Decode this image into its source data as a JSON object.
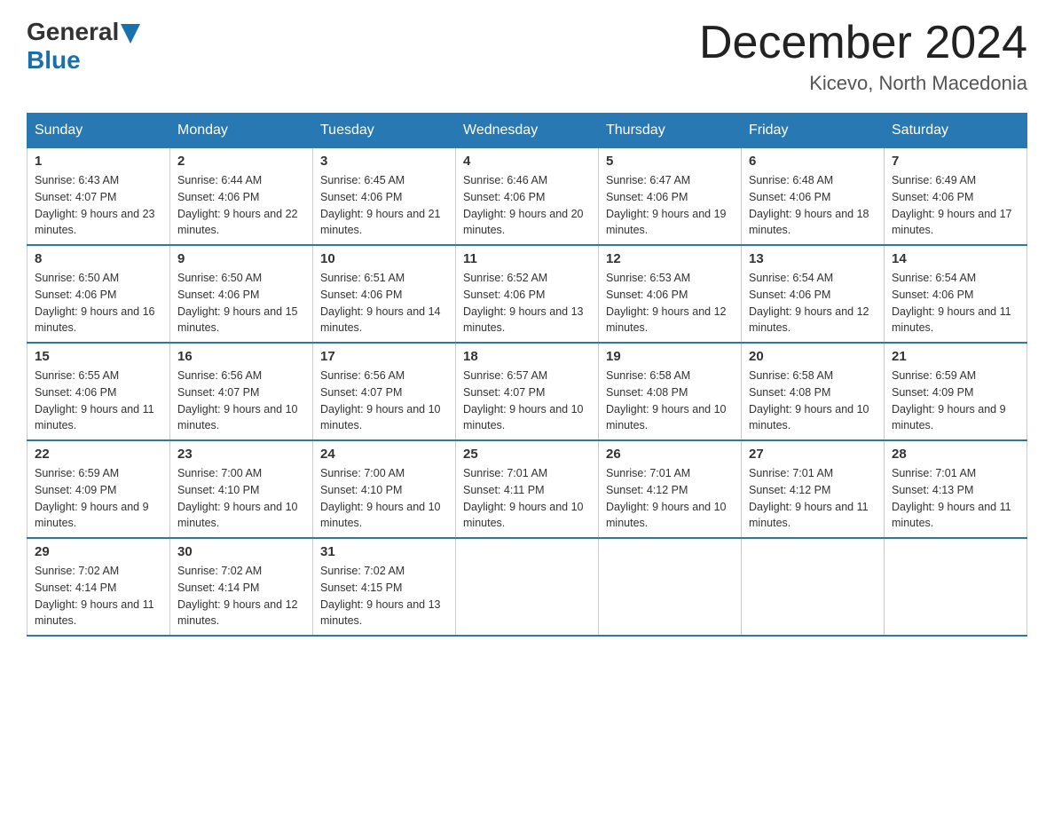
{
  "header": {
    "logo_general": "General",
    "logo_blue": "Blue",
    "month_title": "December 2024",
    "location": "Kicevo, North Macedonia"
  },
  "days_of_week": [
    "Sunday",
    "Monday",
    "Tuesday",
    "Wednesday",
    "Thursday",
    "Friday",
    "Saturday"
  ],
  "weeks": [
    [
      {
        "day": "1",
        "sunrise": "6:43 AM",
        "sunset": "4:07 PM",
        "daylight": "9 hours and 23 minutes."
      },
      {
        "day": "2",
        "sunrise": "6:44 AM",
        "sunset": "4:06 PM",
        "daylight": "9 hours and 22 minutes."
      },
      {
        "day": "3",
        "sunrise": "6:45 AM",
        "sunset": "4:06 PM",
        "daylight": "9 hours and 21 minutes."
      },
      {
        "day": "4",
        "sunrise": "6:46 AM",
        "sunset": "4:06 PM",
        "daylight": "9 hours and 20 minutes."
      },
      {
        "day": "5",
        "sunrise": "6:47 AM",
        "sunset": "4:06 PM",
        "daylight": "9 hours and 19 minutes."
      },
      {
        "day": "6",
        "sunrise": "6:48 AM",
        "sunset": "4:06 PM",
        "daylight": "9 hours and 18 minutes."
      },
      {
        "day": "7",
        "sunrise": "6:49 AM",
        "sunset": "4:06 PM",
        "daylight": "9 hours and 17 minutes."
      }
    ],
    [
      {
        "day": "8",
        "sunrise": "6:50 AM",
        "sunset": "4:06 PM",
        "daylight": "9 hours and 16 minutes."
      },
      {
        "day": "9",
        "sunrise": "6:50 AM",
        "sunset": "4:06 PM",
        "daylight": "9 hours and 15 minutes."
      },
      {
        "day": "10",
        "sunrise": "6:51 AM",
        "sunset": "4:06 PM",
        "daylight": "9 hours and 14 minutes."
      },
      {
        "day": "11",
        "sunrise": "6:52 AM",
        "sunset": "4:06 PM",
        "daylight": "9 hours and 13 minutes."
      },
      {
        "day": "12",
        "sunrise": "6:53 AM",
        "sunset": "4:06 PM",
        "daylight": "9 hours and 12 minutes."
      },
      {
        "day": "13",
        "sunrise": "6:54 AM",
        "sunset": "4:06 PM",
        "daylight": "9 hours and 12 minutes."
      },
      {
        "day": "14",
        "sunrise": "6:54 AM",
        "sunset": "4:06 PM",
        "daylight": "9 hours and 11 minutes."
      }
    ],
    [
      {
        "day": "15",
        "sunrise": "6:55 AM",
        "sunset": "4:06 PM",
        "daylight": "9 hours and 11 minutes."
      },
      {
        "day": "16",
        "sunrise": "6:56 AM",
        "sunset": "4:07 PM",
        "daylight": "9 hours and 10 minutes."
      },
      {
        "day": "17",
        "sunrise": "6:56 AM",
        "sunset": "4:07 PM",
        "daylight": "9 hours and 10 minutes."
      },
      {
        "day": "18",
        "sunrise": "6:57 AM",
        "sunset": "4:07 PM",
        "daylight": "9 hours and 10 minutes."
      },
      {
        "day": "19",
        "sunrise": "6:58 AM",
        "sunset": "4:08 PM",
        "daylight": "9 hours and 10 minutes."
      },
      {
        "day": "20",
        "sunrise": "6:58 AM",
        "sunset": "4:08 PM",
        "daylight": "9 hours and 10 minutes."
      },
      {
        "day": "21",
        "sunrise": "6:59 AM",
        "sunset": "4:09 PM",
        "daylight": "9 hours and 9 minutes."
      }
    ],
    [
      {
        "day": "22",
        "sunrise": "6:59 AM",
        "sunset": "4:09 PM",
        "daylight": "9 hours and 9 minutes."
      },
      {
        "day": "23",
        "sunrise": "7:00 AM",
        "sunset": "4:10 PM",
        "daylight": "9 hours and 10 minutes."
      },
      {
        "day": "24",
        "sunrise": "7:00 AM",
        "sunset": "4:10 PM",
        "daylight": "9 hours and 10 minutes."
      },
      {
        "day": "25",
        "sunrise": "7:01 AM",
        "sunset": "4:11 PM",
        "daylight": "9 hours and 10 minutes."
      },
      {
        "day": "26",
        "sunrise": "7:01 AM",
        "sunset": "4:12 PM",
        "daylight": "9 hours and 10 minutes."
      },
      {
        "day": "27",
        "sunrise": "7:01 AM",
        "sunset": "4:12 PM",
        "daylight": "9 hours and 11 minutes."
      },
      {
        "day": "28",
        "sunrise": "7:01 AM",
        "sunset": "4:13 PM",
        "daylight": "9 hours and 11 minutes."
      }
    ],
    [
      {
        "day": "29",
        "sunrise": "7:02 AM",
        "sunset": "4:14 PM",
        "daylight": "9 hours and 11 minutes."
      },
      {
        "day": "30",
        "sunrise": "7:02 AM",
        "sunset": "4:14 PM",
        "daylight": "9 hours and 12 minutes."
      },
      {
        "day": "31",
        "sunrise": "7:02 AM",
        "sunset": "4:15 PM",
        "daylight": "9 hours and 13 minutes."
      },
      null,
      null,
      null,
      null
    ]
  ]
}
